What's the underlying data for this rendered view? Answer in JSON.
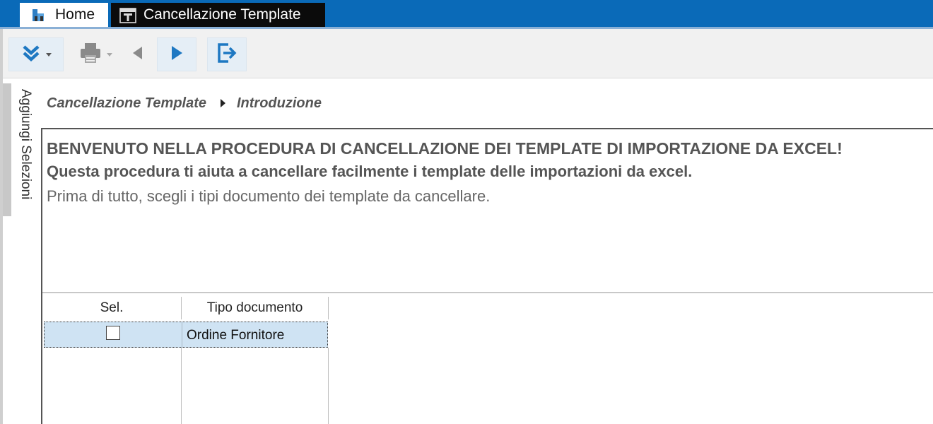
{
  "tabs": [
    {
      "label": "Home",
      "icon": "home-app-icon"
    },
    {
      "label": "Cancellazione Template",
      "icon": "template-icon",
      "active": true
    }
  ],
  "toolbar": {
    "buttons": [
      {
        "name": "expand-menu-button",
        "icon": "double-chevron-down-icon",
        "has_dropdown": true
      },
      {
        "name": "print-button",
        "icon": "printer-icon",
        "has_dropdown": true,
        "enabled": false
      },
      {
        "name": "back-button",
        "icon": "triangle-left-icon",
        "enabled": false
      },
      {
        "name": "next-button",
        "icon": "triangle-right-icon",
        "enabled": true
      },
      {
        "name": "exit-button",
        "icon": "exit-icon",
        "enabled": true
      }
    ]
  },
  "sidebar": {
    "label": "Aggiungi Selezioni"
  },
  "breadcrumb": {
    "root": "Cancellazione Template",
    "current": "Introduzione"
  },
  "welcome": {
    "line1": "BENVENUTO NELLA PROCEDURA DI CANCELLAZIONE DEI TEMPLATE DI IMPORTAZIONE DA EXCEL!",
    "line2": "Questa procedura ti aiuta a cancellare facilmente i template delle importazioni da excel.",
    "line3": "Prima di tutto, scegli i tipi documento dei template da cancellare."
  },
  "grid": {
    "columns": [
      "Sel.",
      "Tipo documento"
    ],
    "rows": [
      {
        "selected": false,
        "tipo": "Ordine Fornitore"
      }
    ]
  },
  "colors": {
    "titlebar": "#0a6ab8",
    "active_tab": "#0b0b0b",
    "toolbar_bg": "#f1f1f1",
    "accent_icon": "#1e78c2",
    "row_selected": "#cfe3f3"
  }
}
